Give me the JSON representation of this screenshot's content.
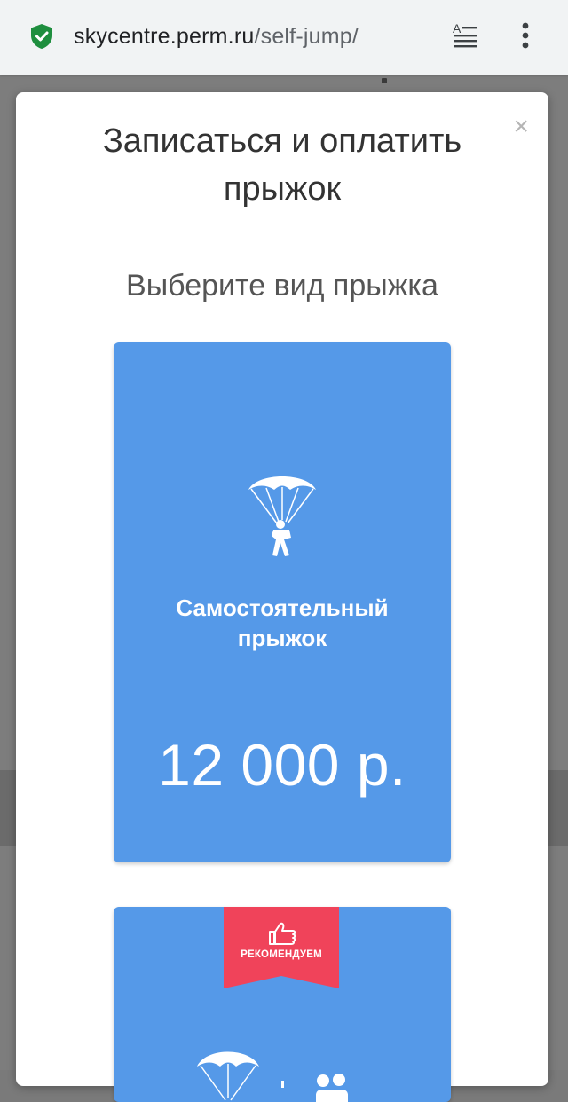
{
  "browser": {
    "url_domain": "skycentre.perm.ru",
    "url_path": "/self-jump/",
    "secure_icon": "shield-check-icon",
    "reader_icon": "reader-mode-icon",
    "menu_icon": "more-vert-icon"
  },
  "modal": {
    "close_label": "×",
    "title_line1": "Записаться и оплатить",
    "title_line2": "прыжок",
    "subtitle": "Выберите вид прыжка"
  },
  "options": [
    {
      "name_line1": "Самостоятельный",
      "name_line2": "прыжок",
      "price": "12 000 р.",
      "icon": "parachutist-icon"
    },
    {
      "badge": "РЕКОМЕНДУЕМ",
      "badge_icon": "thumbs-up-icon",
      "icon": "tandem-parachute-icon"
    }
  ],
  "colors": {
    "card_blue": "#5599e8",
    "badge_red": "#f0435a",
    "secure_green": "#1e8e3e",
    "overlay_gray": "#7d7d7d"
  }
}
